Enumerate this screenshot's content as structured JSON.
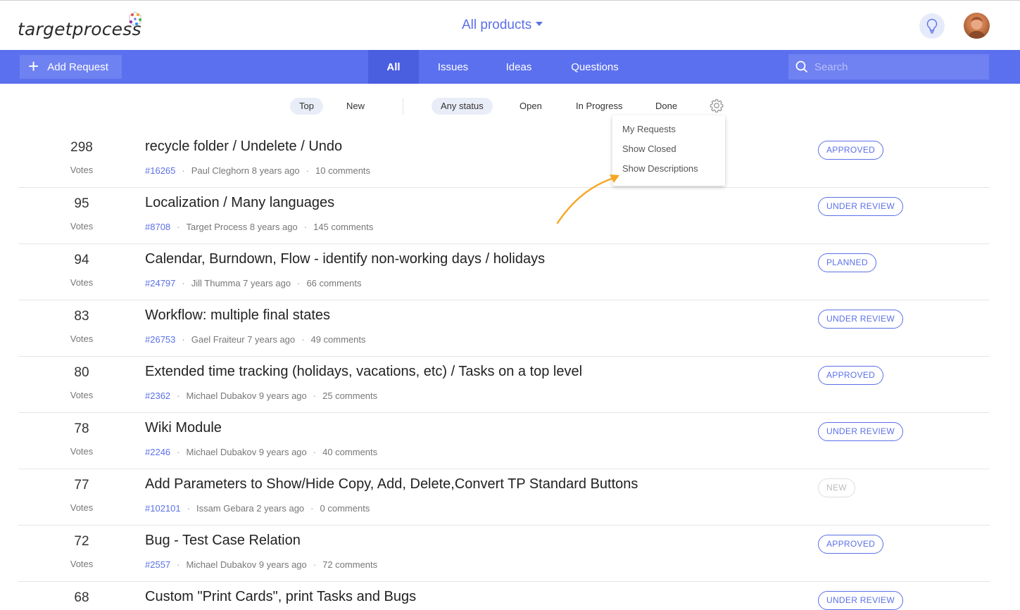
{
  "header": {
    "logo_text": "targetprocess",
    "products_label": "All products",
    "colors": {
      "accent": "#5b70ee",
      "brand": "#5b70e8"
    }
  },
  "navbar": {
    "add_request_label": "Add Request",
    "tabs": [
      {
        "label": "All",
        "active": true
      },
      {
        "label": "Issues",
        "active": false
      },
      {
        "label": "Ideas",
        "active": false
      },
      {
        "label": "Questions",
        "active": false
      }
    ],
    "search_placeholder": "Search"
  },
  "filters": {
    "sort": [
      {
        "label": "Top",
        "active": true
      },
      {
        "label": "New",
        "active": false
      }
    ],
    "status": [
      {
        "label": "Any status",
        "active": true
      },
      {
        "label": "Open",
        "active": false
      },
      {
        "label": "In Progress",
        "active": false
      },
      {
        "label": "Done",
        "active": false
      }
    ]
  },
  "settings_menu": {
    "items": [
      "My Requests",
      "Show Closed",
      "Show Descriptions"
    ]
  },
  "requests": [
    {
      "votes": "298",
      "votes_label": "Votes",
      "title": "recycle folder / Undelete / Undo",
      "id": "#16265",
      "author": "Paul Cleghorn 8 years ago",
      "comments": "10 comments",
      "status": "APPROVED"
    },
    {
      "votes": "95",
      "votes_label": "Votes",
      "title": "Localization / Many languages",
      "id": "#8708",
      "author": "Target Process 8 years ago",
      "comments": "145 comments",
      "status": "UNDER REVIEW"
    },
    {
      "votes": "94",
      "votes_label": "Votes",
      "title": "Calendar, Burndown, Flow - identify non-working days / holidays",
      "id": "#24797",
      "author": "Jill Thumma 7 years ago",
      "comments": "66 comments",
      "status": "PLANNED"
    },
    {
      "votes": "83",
      "votes_label": "Votes",
      "title": "Workflow: multiple final states",
      "id": "#26753",
      "author": "Gael Fraiteur 7 years ago",
      "comments": "49 comments",
      "status": "UNDER REVIEW"
    },
    {
      "votes": "80",
      "votes_label": "Votes",
      "title": "Extended time tracking (holidays, vacations, etc) / Tasks on a top level",
      "id": "#2362",
      "author": "Michael Dubakov 9 years ago",
      "comments": "25 comments",
      "status": "APPROVED"
    },
    {
      "votes": "78",
      "votes_label": "Votes",
      "title": "Wiki Module",
      "id": "#2246",
      "author": "Michael Dubakov 9 years ago",
      "comments": "40 comments",
      "status": "UNDER REVIEW"
    },
    {
      "votes": "77",
      "votes_label": "Votes",
      "title": "Add Parameters to Show/Hide Copy, Add, Delete,Convert TP Standard Buttons",
      "id": "#102101",
      "author": "Issam Gebara 2 years ago",
      "comments": "0 comments",
      "status": "NEW"
    },
    {
      "votes": "72",
      "votes_label": "Votes",
      "title": "Bug - Test Case Relation",
      "id": "#2557",
      "author": "Michael Dubakov 9 years ago",
      "comments": "72 comments",
      "status": "APPROVED"
    },
    {
      "votes": "68",
      "votes_label": "",
      "title": "Custom \"Print Cards\", print Tasks and Bugs",
      "id": "",
      "author": "",
      "comments": "",
      "status": "UNDER REVIEW"
    }
  ]
}
